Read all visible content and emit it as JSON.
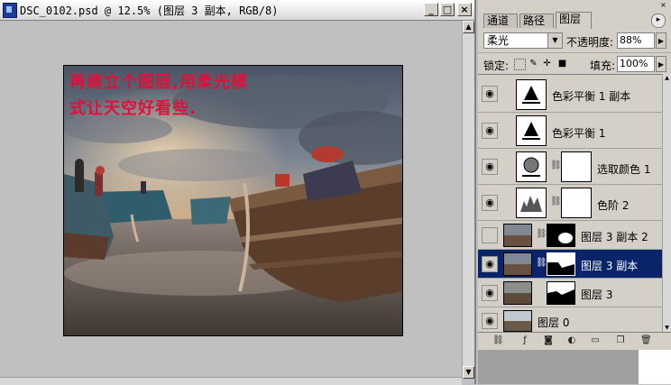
{
  "document": {
    "title": "DSC_0102.psd @ 12.5% (图层 3 副本, RGB/8)",
    "buttons": {
      "minimize": "_",
      "maximize": "□",
      "close": "×"
    },
    "overlay_text": [
      "再建立个图层,用柔光模",
      "式让天空好看些."
    ]
  },
  "palette": {
    "tabs": [
      "通道",
      "路径",
      "图层"
    ],
    "active_tab": "图层",
    "blend_mode": "柔光",
    "opacity_label": "不透明度:",
    "opacity_value": "88%",
    "lock_label": "锁定:",
    "fill_label": "填充:",
    "fill_value": "100%",
    "layers": [
      {
        "name": "色彩平衡 1 副本",
        "visible": true,
        "type": "adjustment",
        "icon": "color-balance-icon"
      },
      {
        "name": "色彩平衡 1",
        "visible": true,
        "type": "adjustment",
        "icon": "color-balance-icon"
      },
      {
        "name": "选取颜色 1",
        "visible": true,
        "type": "adjustment-mask",
        "icon": "selective-color-icon"
      },
      {
        "name": "色阶 2",
        "visible": true,
        "type": "adjustment-mask",
        "icon": "levels-icon"
      },
      {
        "name": "图层 3 副本 2",
        "visible": false,
        "type": "image-mask"
      },
      {
        "name": "图层 3 副本",
        "visible": true,
        "type": "image-mask",
        "selected": true
      },
      {
        "name": "图层 3",
        "visible": true,
        "type": "image-mask"
      },
      {
        "name": "图层 0",
        "visible": true,
        "type": "image"
      }
    ],
    "footer_icons": [
      "link-icon",
      "layer-style-icon",
      "mask-icon",
      "new-set-icon",
      "new-fill-layer-icon",
      "new-layer-icon",
      "trash-icon"
    ]
  },
  "colors": {
    "selection": "#0a246a",
    "overlay_text": "#e0103a",
    "panel": "#d4d0c8"
  }
}
